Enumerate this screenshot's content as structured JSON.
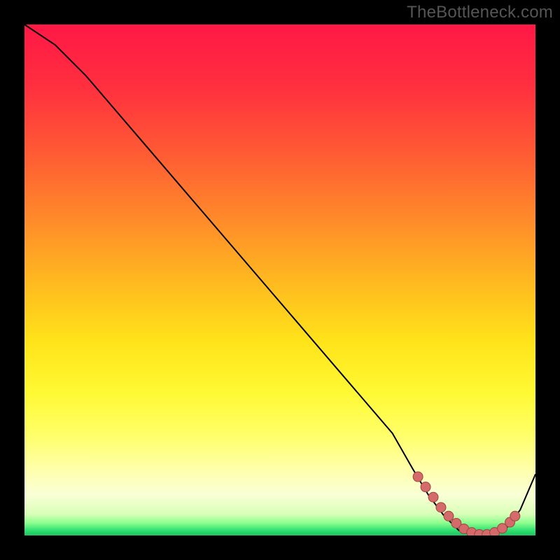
{
  "watermark": "TheBottleneck.com",
  "colors": {
    "background": "#000000",
    "gradient_stops": [
      {
        "offset": 0.0,
        "color": "#ff1846"
      },
      {
        "offset": 0.12,
        "color": "#ff2f3f"
      },
      {
        "offset": 0.25,
        "color": "#ff5a34"
      },
      {
        "offset": 0.38,
        "color": "#ff8a2a"
      },
      {
        "offset": 0.5,
        "color": "#ffb820"
      },
      {
        "offset": 0.62,
        "color": "#ffe31a"
      },
      {
        "offset": 0.72,
        "color": "#fff933"
      },
      {
        "offset": 0.8,
        "color": "#ffff66"
      },
      {
        "offset": 0.87,
        "color": "#ffffaa"
      },
      {
        "offset": 0.92,
        "color": "#faffd6"
      },
      {
        "offset": 0.958,
        "color": "#d9ffb8"
      },
      {
        "offset": 0.975,
        "color": "#8fff8f"
      },
      {
        "offset": 0.99,
        "color": "#30e070"
      },
      {
        "offset": 1.0,
        "color": "#1bc45f"
      }
    ],
    "curve_stroke": "#000000",
    "marker_fill": "#d46a6a",
    "marker_stroke": "#a04444"
  },
  "chart_data": {
    "type": "line",
    "title": "",
    "xlabel": "",
    "ylabel": "",
    "xlim": [
      0,
      100
    ],
    "ylim": [
      0,
      100
    ],
    "grid": false,
    "legend": false,
    "series": [
      {
        "name": "curve",
        "x": [
          0,
          6,
          12,
          18,
          24,
          30,
          36,
          42,
          48,
          54,
          60,
          66,
          72,
          76,
          79,
          82,
          85,
          88,
          91,
          94,
          97,
          100
        ],
        "y": [
          100,
          96,
          90,
          83,
          76,
          69,
          62,
          55,
          48,
          41,
          34,
          27,
          20,
          13,
          8,
          4,
          1,
          0,
          0,
          1,
          5,
          12
        ]
      }
    ],
    "markers": {
      "name": "highlighted-points",
      "x": [
        77,
        78.5,
        80,
        81.5,
        83,
        84.5,
        86,
        87.5,
        89,
        90.5,
        92,
        93.5,
        95,
        96
      ],
      "y": [
        11.5,
        9.5,
        7.5,
        5.5,
        3.8,
        2.4,
        1.3,
        0.6,
        0.2,
        0.2,
        0.6,
        1.4,
        2.6,
        3.8
      ]
    }
  }
}
